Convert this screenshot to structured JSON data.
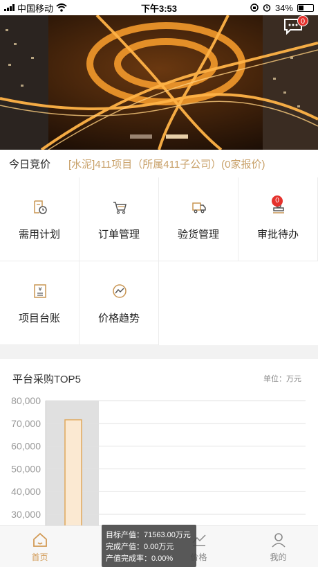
{
  "status_bar": {
    "carrier": "中国移动",
    "time": "下午3:53",
    "battery": "34%",
    "battery_level": 0.34
  },
  "banner": {
    "message_badge": "0",
    "active_slide": 1,
    "slide_count": 2
  },
  "bid": {
    "label": "今日竞价",
    "text": "[水泥]411项目（所属411子公司）(0家报价)"
  },
  "menu": [
    {
      "label": "需用计划",
      "icon": "plan-clock-icon"
    },
    {
      "label": "订单管理",
      "icon": "cart-icon"
    },
    {
      "label": "验货管理",
      "icon": "truck-icon"
    },
    {
      "label": "审批待办",
      "icon": "stamp-icon",
      "badge": "0"
    },
    {
      "label": "项目台账",
      "icon": "ledger-yen-icon"
    },
    {
      "label": "价格趋势",
      "icon": "trend-icon"
    }
  ],
  "chart": {
    "title": "平台采购TOP5",
    "unit": "单位：万元"
  },
  "chart_data": {
    "type": "bar",
    "title": "平台采购TOP5",
    "unit": "万元",
    "y_ticks": [
      30000,
      40000,
      50000,
      60000,
      70000,
      80000
    ],
    "ylim": [
      25000,
      80000
    ],
    "grid": true,
    "series": [
      {
        "values": [
          71563
        ]
      }
    ],
    "highlighted_index": 0,
    "colors": {
      "bar_stroke": "#e0a85a",
      "highlight": "#e0e0e0",
      "grid": "#e2e2e2"
    }
  },
  "tooltip": {
    "line1": "目标产值：71563.00万元",
    "line2": "完成产值：0.00万元",
    "line3": "产值完成率：0.00%"
  },
  "tabs": [
    {
      "label": "首页",
      "icon": "home-icon",
      "active": true
    },
    {
      "label": "",
      "icon": "",
      "active": false
    },
    {
      "label": "价格",
      "icon": "price-chart-icon",
      "active": false
    },
    {
      "label": "我的",
      "icon": "user-icon",
      "active": false
    }
  ],
  "colors": {
    "accent": "#d29a55",
    "bid_text": "#c8a068",
    "badge": "#e5322d"
  }
}
